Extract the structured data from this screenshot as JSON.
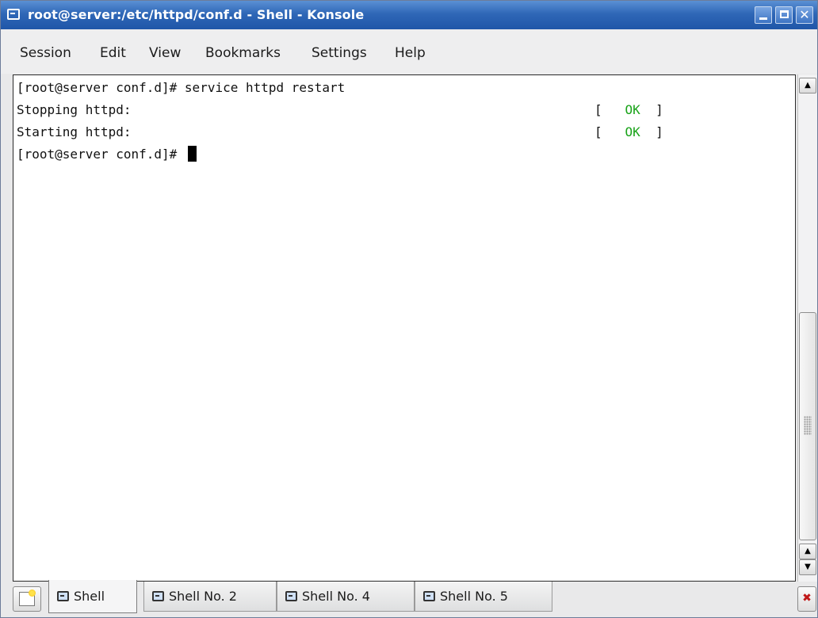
{
  "window": {
    "title": "root@server:/etc/httpd/conf.d - Shell - Konsole",
    "controls": [
      "minimize-icon",
      "maximize-icon",
      "close-icon"
    ]
  },
  "menubar": {
    "items": [
      "Session",
      "Edit",
      "View",
      "Bookmarks",
      "Settings",
      "Help"
    ]
  },
  "terminal": {
    "lines": [
      {
        "text": "[root@server conf.d]# service httpd restart"
      },
      {
        "text": "Stopping httpd:",
        "status_open": "[",
        "status": "OK",
        "status_close": "]"
      },
      {
        "text": "Starting httpd:",
        "status_open": "[",
        "status": "OK",
        "status_close": "]"
      },
      {
        "text": "[root@server conf.d]# "
      }
    ],
    "ok_color": "#1aa31a"
  },
  "tabs": [
    {
      "label": "Shell",
      "active": true
    },
    {
      "label": "Shell No. 2",
      "active": false
    },
    {
      "label": "Shell No. 4",
      "active": false
    },
    {
      "label": "Shell No. 5",
      "active": false
    }
  ],
  "colors": {
    "titlebar": "#2f67b7",
    "terminal_bg": "#ffffff",
    "terminal_fg": "#111111"
  }
}
